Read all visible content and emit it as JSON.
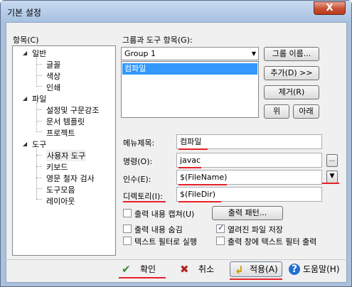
{
  "window": {
    "title": "기본 설정",
    "close_label": "X"
  },
  "tree": {
    "label": "항목(C)",
    "groups": [
      {
        "label": "일반",
        "items": [
          "글꼴",
          "색상",
          "인쇄"
        ]
      },
      {
        "label": "파일",
        "items": [
          "설정및 구문강조",
          "문서 템플릿",
          "프로젝트"
        ]
      },
      {
        "label": "도구",
        "items": [
          "사용자 도구",
          "키보드",
          "영문 철자 검사",
          "도구모음",
          "레이아웃"
        ]
      }
    ]
  },
  "groups_section": {
    "label": "그룹과 도구 항목(G):",
    "combo_value": "Group 1",
    "list_items": [
      "컴파일"
    ]
  },
  "side_buttons": {
    "group_name": "그룹 이름...",
    "add": "추가(D) >>",
    "remove": "제거(R)",
    "up": "위",
    "down": "아래"
  },
  "fields": {
    "menu_title_label": "메뉴제목:",
    "menu_title_value": "컴파일",
    "command_label": "명령(O):",
    "command_value": "javac",
    "args_label": "인수(E):",
    "args_value": "$(FileName)",
    "dir_label": "디렉토리(I):",
    "dir_value": "$(FileDir)",
    "browse_label": "..."
  },
  "options": {
    "capture_output": {
      "label": "출력 내용 캡쳐(U)",
      "checked": false
    },
    "output_pattern_button": "출력 패턴...",
    "hide_output": {
      "label": "출력 내용 숨김",
      "checked": false
    },
    "save_open_files": {
      "label": "열려진 파일 저장",
      "checked": true
    },
    "text_filter": {
      "label": "텍스트 필터로 실행",
      "checked": false
    },
    "output_filter": {
      "label": "출력 창에 텍스트 필터 출력",
      "checked": false
    }
  },
  "footer": {
    "ok": "확인",
    "cancel": "취소",
    "apply": "적용(A)",
    "help": "도움말(H)"
  },
  "colors": {
    "annotation_red": "#e8202a",
    "selection_blue": "#3399ff",
    "title_gradient": "#c9daf0"
  }
}
